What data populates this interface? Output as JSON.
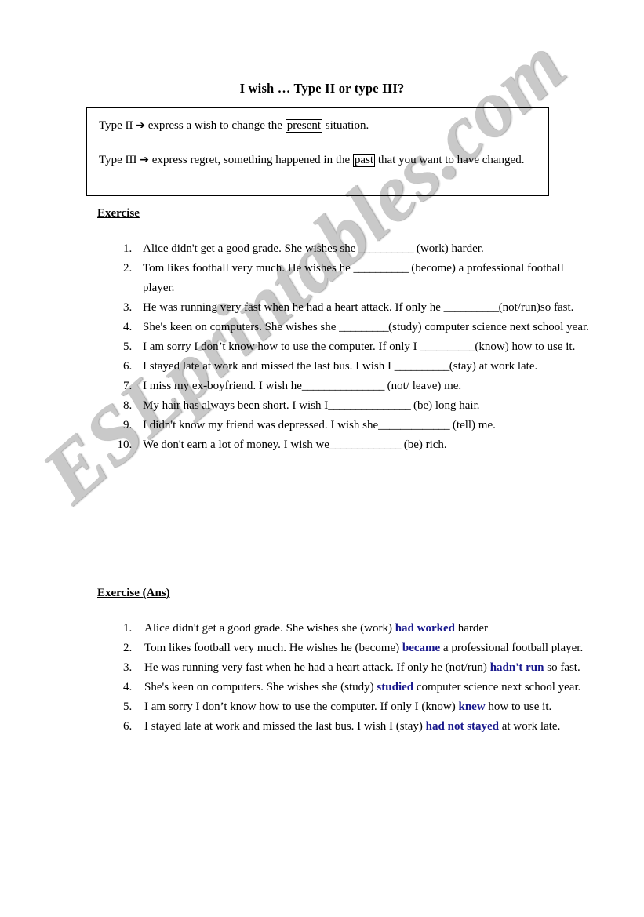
{
  "document": {
    "title": "I wish …  Type II or type III?"
  },
  "definition_box": {
    "line1_prefix": "Type II",
    "line1_arrow": "➔",
    "line1_text_before": "express a wish to change the",
    "line1_keyword": "present",
    "line1_text_after": "situation.",
    "line2_prefix": "Type III",
    "line2_arrow": "➔",
    "line2_text_before": "express regret, something happened in the",
    "line2_keyword": "past",
    "line2_text_after": "that you want to have changed."
  },
  "exercise": {
    "heading": "Exercise",
    "blank_short": "__________",
    "blank_long": "______________",
    "items": [
      {
        "before": "Alice didn't get a good grade. She wishes she ",
        "blank": "__________",
        "after": " (work) harder."
      },
      {
        "before": "Tom likes football very much. He wishes he ",
        "blank": "__________",
        "after": " (become) a professional football player."
      },
      {
        "before": "He was running very fast when he had a heart attack. If only he ",
        "blank": "__________",
        "after": "(not/run)so fast."
      },
      {
        "before": "She's keen on computers. She wishes she ",
        "blank": "_________",
        "after": "(study) computer science next school year."
      },
      {
        "before": "I am sorry I don’t know how to use the computer. If only I ",
        "blank": "__________",
        "after": "(know) how to use it."
      },
      {
        "before": "I stayed late at work and missed the last bus. I wish I ",
        "blank": "__________",
        "after": "(stay) at work late."
      },
      {
        "before": "I miss my ex-boyfriend. I wish he",
        "blank": "_______________",
        "after": " (not/ leave) me."
      },
      {
        "before": "My hair has always been short. I wish I",
        "blank": "_______________",
        "after": " (be) long hair."
      },
      {
        "before": "I didn't know my friend was depressed. I wish she",
        "blank": "_____________",
        "after": " (tell) me."
      },
      {
        "before": "We don't earn a lot of money. I wish we",
        "blank": "_____________",
        "after": " (be) rich."
      }
    ]
  },
  "answers": {
    "heading": "Exercise (Ans)",
    "items": [
      {
        "before": "Alice didn't get a good grade. She wishes she (work) ",
        "answer": "had worked",
        "after": " harder"
      },
      {
        "before": "Tom likes football very much. He wishes he (become) ",
        "answer": "became",
        "after": " a professional football player."
      },
      {
        "before": "He was running very fast when he had a heart attack. If only he (not/run) ",
        "answer": "hadn't run",
        "after": " so fast."
      },
      {
        "before": "She's keen on computers. She wishes she (study) ",
        "answer": "studied",
        "after": " computer science next school year."
      },
      {
        "before": "I am sorry I don’t know how to use the computer. If only I (know) ",
        "answer": "knew",
        "after": " how to use it."
      },
      {
        "before": "I stayed late at work and missed the last bus. I wish I (stay) ",
        "answer": "had not stayed",
        "after": " at work late."
      }
    ]
  },
  "watermark": {
    "text": "ESLprintables.com",
    "color": "#c9c9c9"
  },
  "colors": {
    "answer_blue": "#18188c",
    "text_black": "#000000",
    "page_background": "#ffffff"
  }
}
